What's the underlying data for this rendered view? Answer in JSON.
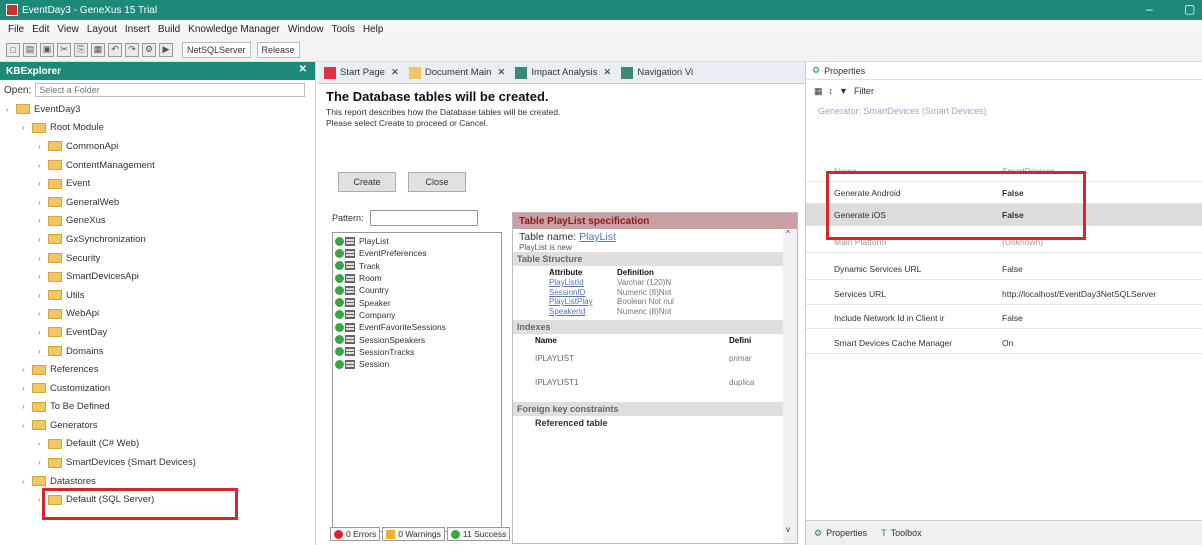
{
  "window": {
    "title": "EventDay3 - GeneXus 15 Trial"
  },
  "menu": [
    "File",
    "Edit",
    "View",
    "Layout",
    "Insert",
    "Build",
    "Knowledge Manager",
    "Window",
    "Tools",
    "Help"
  ],
  "toolbar": {
    "env": "NetSQLServer",
    "config": "Release"
  },
  "kb": {
    "title": "KBExplorer",
    "open_label": "Open:",
    "open_placeholder": "Select a Folder",
    "tree": [
      {
        "label": "EventDay3",
        "indent": 0
      },
      {
        "label": "Root Module",
        "indent": 1
      },
      {
        "label": "CommonApi",
        "indent": 2
      },
      {
        "label": "ContentManagement",
        "indent": 2
      },
      {
        "label": "Event",
        "indent": 2
      },
      {
        "label": "GeneralWeb",
        "indent": 2
      },
      {
        "label": "GeneXus",
        "indent": 2
      },
      {
        "label": "GxSynchronization",
        "indent": 2
      },
      {
        "label": "Security",
        "indent": 2
      },
      {
        "label": "SmartDevicesApi",
        "indent": 2
      },
      {
        "label": "Utils",
        "indent": 2
      },
      {
        "label": "WebApi",
        "indent": 2
      },
      {
        "label": "EventDay",
        "indent": 2
      },
      {
        "label": "Domains",
        "indent": 2
      },
      {
        "label": "References",
        "indent": 1
      },
      {
        "label": "Customization",
        "indent": 1
      },
      {
        "label": "To Be Defined",
        "indent": 1
      },
      {
        "label": "Generators",
        "indent": 1
      },
      {
        "label": "Default (C# Web)",
        "indent": 2
      },
      {
        "label": "SmartDevices (Smart Devices)",
        "indent": 2
      },
      {
        "label": "Datastores",
        "indent": 1
      },
      {
        "label": "Default (SQL Server)",
        "indent": 2
      }
    ]
  },
  "center": {
    "tabs": [
      "Start Page",
      "Document Main",
      "Impact Analysis",
      "Navigation Vi"
    ],
    "title": "The Database tables will be created.",
    "desc1": "This report describes how the Database tables will be created.",
    "desc2": "Please select Create to proceed or Cancel.",
    "create_btn": "Create",
    "close_btn": "Close",
    "pattern_label": "Pattern:",
    "tables": [
      "PlayList",
      "EventPreferences",
      "Track",
      "Room",
      "Country",
      "Speaker",
      "Company",
      "EventFavoriteSessions",
      "SessionSpeakers",
      "SessionTracks",
      "Session"
    ],
    "spec": {
      "head": "Table PlayList specification",
      "table_name_label": "Table name:",
      "table_name": "PlayList",
      "is_new": "PlayList is new",
      "structure": "Table Structure",
      "attr_h": "Attribute",
      "def_h": "Definition",
      "attrs": [
        {
          "a": "PlayListId",
          "d": "Varchar (120)N"
        },
        {
          "a": "SessionID",
          "d": "Numeric (8)Not"
        },
        {
          "a": "PlayListPlay",
          "d": "Boolean Not nul"
        },
        {
          "a": "SpeakerId",
          "d": "Numeric (8)Not"
        }
      ],
      "indexes": "Indexes",
      "idx_name_h": "Name",
      "idx_def_h": "Defini",
      "idx": [
        {
          "n": "IPLAYLIST",
          "d": "primar"
        },
        {
          "n": "IPLAYLIST1",
          "d": "duplica"
        }
      ],
      "fk": "Foreign key constraints",
      "ref_table": "Referenced table"
    },
    "status": {
      "errors": "0 Errors",
      "warnings": "0 Warnings",
      "success": "11 Success"
    }
  },
  "props": {
    "title": "Properties",
    "filter": "Filter",
    "group": "Generator: SmartDevices (Smart Devices)",
    "rows": [
      {
        "k": "Name",
        "v": "SmartDevices"
      },
      {
        "k": "Generate Android",
        "v": "False"
      },
      {
        "k": "Generate iOS",
        "v": "False"
      },
      {
        "k": "Main Platform",
        "v": "(Unknown)"
      },
      {
        "k": "Dynamic Services URL",
        "v": "False"
      },
      {
        "k": "Services URL",
        "v": "http://localhost/EventDay3NetSQLServer"
      },
      {
        "k": "Include Network Id in Client ir",
        "v": "False"
      },
      {
        "k": "Smart Devices Cache Manager",
        "v": "On"
      }
    ],
    "foot_props": "Properties",
    "foot_toolbox": "Toolbox"
  }
}
